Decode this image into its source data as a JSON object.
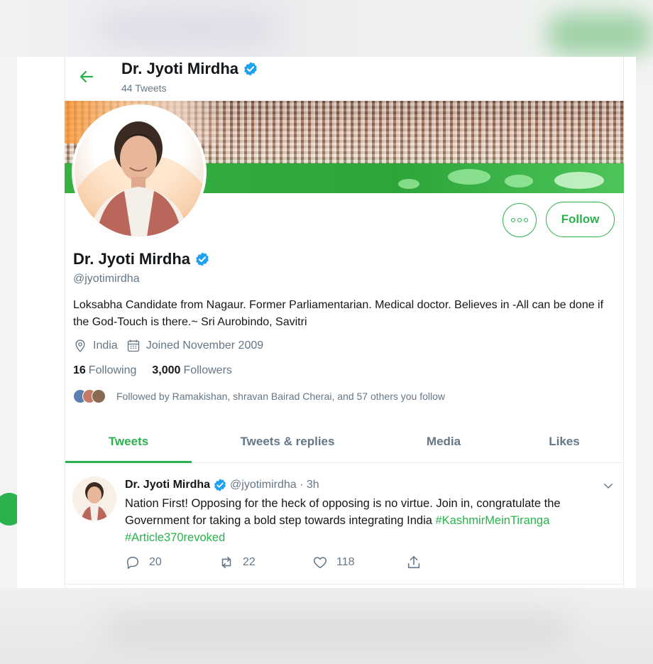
{
  "header": {
    "name": "Dr. Jyoti Mirdha",
    "tweet_count": "44 Tweets"
  },
  "profile": {
    "name": "Dr. Jyoti Mirdha",
    "handle": "@jyotimirdha",
    "bio": "Loksabha Candidate from Nagaur. Former Parliamentarian. Medical doctor. Believes in -All can be done if the God-Touch is there.~ Sri Aurobindo, Savitri",
    "location": "India",
    "joined": "Joined November 2009",
    "following_count": "16",
    "following_label": "Following",
    "followers_count": "3,000",
    "followers_label": "Followers",
    "followed_by": "Followed by Ramakishan, shravan Bairad Cherai, and 57 others you follow"
  },
  "actions": {
    "follow_label": "Follow",
    "more_icon": "more-icon"
  },
  "tabs": [
    {
      "label": "Tweets",
      "active": true
    },
    {
      "label": "Tweets & replies",
      "active": false
    },
    {
      "label": "Media",
      "active": false
    },
    {
      "label": "Likes",
      "active": false
    }
  ],
  "tweet": {
    "name": "Dr. Jyoti Mirdha",
    "handle_time": "@jyotimirdha · 3h",
    "text": "Nation First! Opposing for the heck of opposing is no virtue. Join in, congratulate the Government for taking a bold step towards integrating India ",
    "hashtag1": "#KashmirMeinTiranga",
    "hashtag2": "#Article370revoked",
    "replies": "20",
    "retweets": "22",
    "likes": "118"
  },
  "colors": {
    "accent": "#2bb24c",
    "verified": "#1da1f2",
    "secondary_text": "#657786"
  }
}
